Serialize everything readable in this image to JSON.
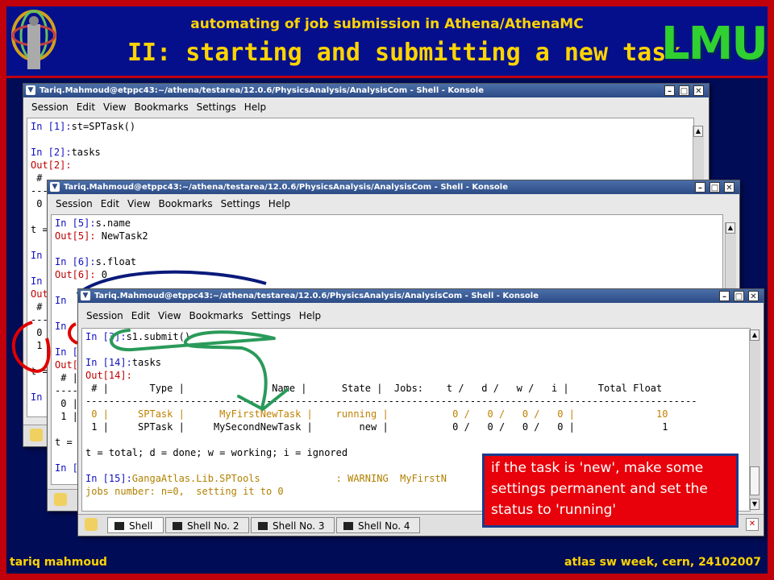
{
  "slide": {
    "subtitle": "automating of job submission in Athena/AthenaMC",
    "title": "II: starting and submitting a new task",
    "logo_text": "LMU",
    "footer_left": "tariq mahmoud",
    "footer_right": "atlas sw week, cern, 24102007"
  },
  "window": {
    "title": "Tariq.Mahmoud@etppc43:~/athena/testarea/12.0.6/PhysicsAnalysis/AnalysisCom - Shell - Konsole",
    "menu": [
      "Session",
      "Edit",
      "View",
      "Bookmarks",
      "Settings",
      "Help"
    ]
  },
  "win1": {
    "lines": [
      {
        "p": "In [1]:",
        "t": "st=SPTask()",
        "c": "b"
      },
      {
        "p": "",
        "t": "",
        "c": ""
      },
      {
        "p": "In [2]:",
        "t": "tasks",
        "c": "b"
      },
      {
        "p": "Out[2]:",
        "t": "",
        "c": "r"
      },
      {
        "p": " #",
        "t": "",
        "c": ""
      },
      {
        "p": "---",
        "t": "",
        "c": ""
      },
      {
        "p": " 0",
        "t": "",
        "c": ""
      },
      {
        "p": "",
        "t": "",
        "c": ""
      },
      {
        "p": "t =",
        "t": "",
        "c": ""
      },
      {
        "p": "",
        "t": "",
        "c": ""
      },
      {
        "p": "In",
        "t": "",
        "c": "b"
      },
      {
        "p": "",
        "t": "",
        "c": ""
      },
      {
        "p": "In",
        "t": "",
        "c": "b"
      },
      {
        "p": "Out",
        "t": "",
        "c": "r"
      },
      {
        "p": " #",
        "t": "",
        "c": ""
      },
      {
        "p": "---",
        "t": "",
        "c": ""
      },
      {
        "p": " 0",
        "t": "",
        "c": ""
      },
      {
        "p": " 1",
        "t": "",
        "c": ""
      },
      {
        "p": "",
        "t": "",
        "c": ""
      },
      {
        "p": "t =",
        "t": "",
        "c": ""
      },
      {
        "p": "",
        "t": "",
        "c": ""
      },
      {
        "p": "In",
        "t": "",
        "c": "b"
      }
    ]
  },
  "win2": {
    "lines": [
      {
        "p": "In [5]:",
        "t": "s.name",
        "c": "b"
      },
      {
        "p": "Out[5]:",
        "t": " NewTask2",
        "c": "r"
      },
      {
        "p": "",
        "t": "",
        "c": ""
      },
      {
        "p": "In [6]:",
        "t": "s.float",
        "c": "b"
      },
      {
        "p": "Out[6]:",
        "t": " 0",
        "c": "r"
      },
      {
        "p": "",
        "t": "",
        "c": ""
      },
      {
        "p": "In",
        "t": "",
        "c": "b"
      },
      {
        "p": "",
        "t": "",
        "c": ""
      },
      {
        "p": "In",
        "t": "",
        "c": "b"
      },
      {
        "p": "",
        "t": "",
        "c": ""
      },
      {
        "p": "In [",
        "t": "",
        "c": "b"
      },
      {
        "p": "Out[",
        "t": "",
        "c": "r"
      },
      {
        "p": " # |",
        "t": "",
        "c": ""
      },
      {
        "p": "----",
        "t": "",
        "c": ""
      },
      {
        "p": " 0 |",
        "t": "",
        "c": ""
      },
      {
        "p": " 1 |",
        "t": "",
        "c": ""
      },
      {
        "p": "",
        "t": "",
        "c": ""
      },
      {
        "p": "t =",
        "t": "",
        "c": ""
      },
      {
        "p": "",
        "t": "",
        "c": ""
      },
      {
        "p": "In [",
        "t": "",
        "c": "b"
      }
    ]
  },
  "win3": {
    "lines": [
      {
        "p": "In [3]:",
        "t": "s1.submit()",
        "c": "b"
      },
      {
        "p": "",
        "t": "",
        "c": ""
      },
      {
        "p": "In [14]:",
        "t": "tasks",
        "c": "b"
      },
      {
        "p": "Out[14]:",
        "t": "",
        "c": "r"
      },
      {
        "p": "",
        "t": " # |       Type |               Name |      State |  Jobs:    t /   d /   w /   i |     Total Float",
        "c": ""
      },
      {
        "p": "",
        "t": "---------------------------------------------------------------------------------------------------------",
        "c": ""
      },
      {
        "p": "",
        "t": " 0 |     SPTask |      MyFirstNewTask |    running |           0 /   0 /   0 /   0 |              10",
        "c": "o"
      },
      {
        "p": "",
        "t": " 1 |     SPTask |     MySecondNewTask |        new |           0 /   0 /   0 /   0 |               1",
        "c": ""
      },
      {
        "p": "",
        "t": "",
        "c": ""
      },
      {
        "p": "",
        "t": "t = total; d = done; w = working; i = ignored",
        "c": ""
      },
      {
        "p": "",
        "t": "",
        "c": ""
      },
      {
        "p": "In [15]:",
        "t": "GangaAtlas.Lib.SPTools             : WARNING  MyFirstN",
        "c": "g"
      },
      {
        "p": "",
        "t": "jobs number: n=0,  setting it to 0",
        "c": "g"
      }
    ],
    "tabs": [
      "Shell",
      "Shell No. 2",
      "Shell No. 3",
      "Shell No. 4"
    ]
  },
  "callout": "if the task is 'new', make some settings permanent and set the status to 'running'",
  "colors": {
    "frame": "#c0000a",
    "band": "#050f8c",
    "title": "#ffd400",
    "accent_green": "#2a9a5a"
  }
}
